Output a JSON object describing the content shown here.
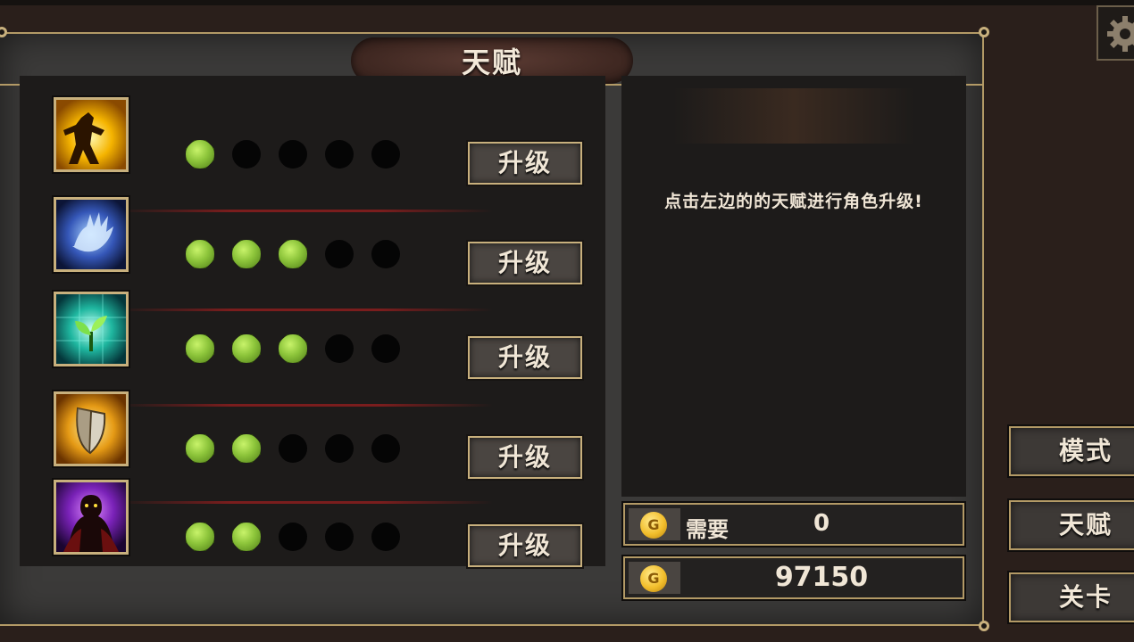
{
  "title": "天赋",
  "talents": [
    {
      "icon": "fire-warrior-icon",
      "level": 1,
      "max": 5,
      "button": "升级"
    },
    {
      "icon": "spirit-hand-icon",
      "level": 3,
      "max": 5,
      "button": "升级"
    },
    {
      "icon": "sprout-icon",
      "level": 3,
      "max": 5,
      "button": "升级"
    },
    {
      "icon": "shield-icon",
      "level": 2,
      "max": 5,
      "button": "升级"
    },
    {
      "icon": "shadow-figure-icon",
      "level": 2,
      "max": 5,
      "button": "升级"
    }
  ],
  "info": {
    "hint": "点击左边的的天赋进行角色升级!"
  },
  "cost": {
    "coin_symbol": "G",
    "label": "需要",
    "value": "0"
  },
  "balance": {
    "coin_symbol": "G",
    "value": "97150"
  },
  "side_buttons": {
    "mode": "模式",
    "talent": "天赋",
    "stage": "关卡"
  },
  "colors": {
    "accent_gold": "#c8b07d",
    "active_dot": "#8cc43a",
    "title_plate": "#4a2e27"
  }
}
